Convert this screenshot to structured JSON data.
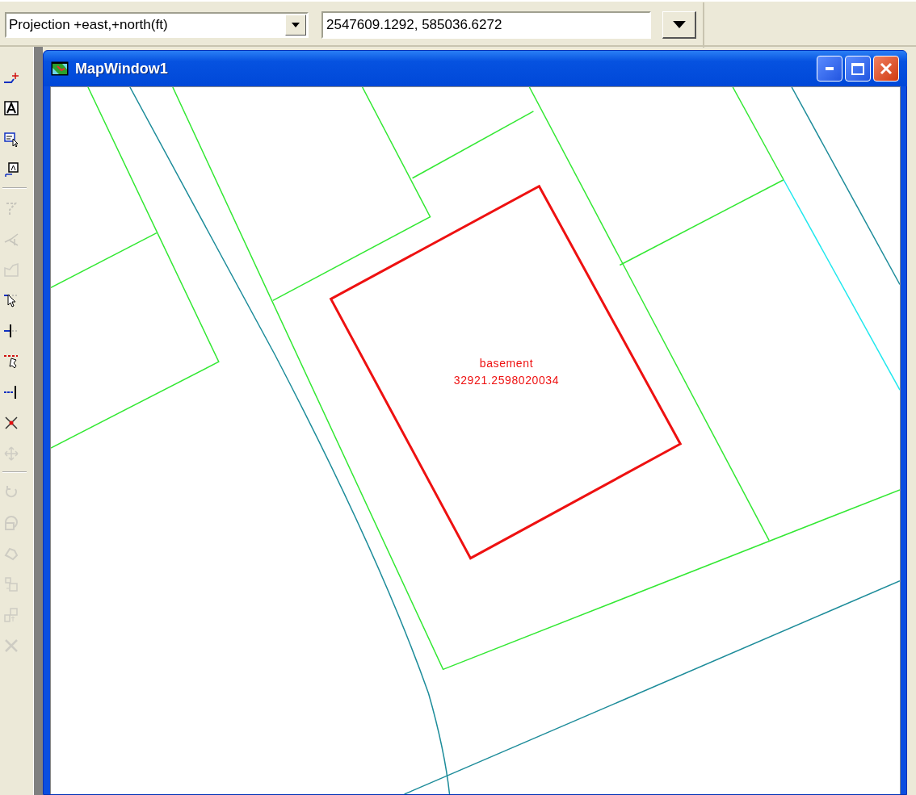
{
  "projection_box": {
    "value": "Projection +east,+north(ft)"
  },
  "coordinate_field": {
    "value": "2547609.1292, 585036.6272"
  },
  "toolbar": {
    "tools": [
      {
        "kind": "add-line",
        "disabled": false
      },
      {
        "kind": "text",
        "disabled": false
      },
      {
        "kind": "label-select",
        "disabled": false
      },
      {
        "kind": "label",
        "disabled": false
      },
      {
        "kind": "separator"
      },
      {
        "kind": "vertex",
        "disabled": true
      },
      {
        "kind": "split",
        "disabled": true
      },
      {
        "kind": "reshape",
        "disabled": true
      },
      {
        "kind": "select",
        "disabled": false
      },
      {
        "kind": "snap-line",
        "disabled": false
      },
      {
        "kind": "dotted-select",
        "disabled": false
      },
      {
        "kind": "line-end",
        "disabled": false
      },
      {
        "kind": "delete-point",
        "disabled": false
      },
      {
        "kind": "move",
        "disabled": true
      },
      {
        "kind": "separator"
      },
      {
        "kind": "rotate",
        "disabled": true
      },
      {
        "kind": "rotate-shape",
        "disabled": true
      },
      {
        "kind": "merge",
        "disabled": true
      },
      {
        "kind": "copy-shape",
        "disabled": true
      },
      {
        "kind": "paste-shape",
        "disabled": true
      },
      {
        "kind": "delete",
        "disabled": true
      }
    ]
  },
  "window": {
    "title": "MapWindow1"
  },
  "map": {
    "labels": [
      {
        "text": "basement"
      },
      {
        "text": "32921.2598020034"
      }
    ]
  }
}
